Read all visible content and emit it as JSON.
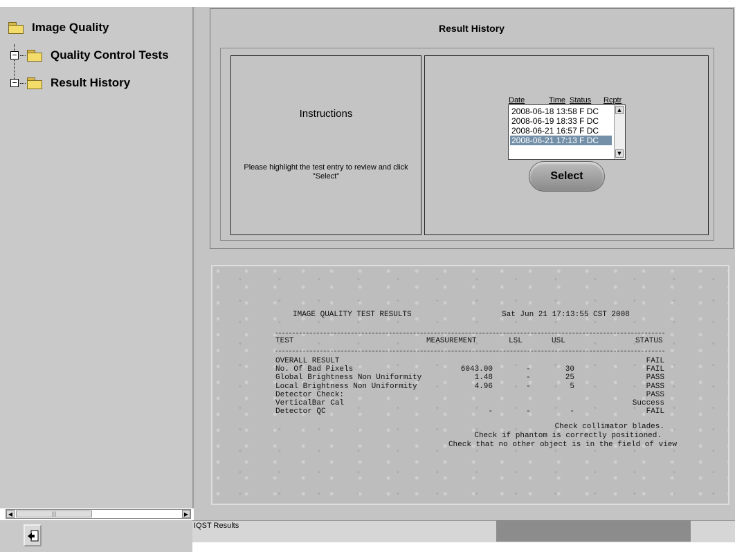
{
  "tree": {
    "root": "Image Quality",
    "children": [
      "Quality Control Tests",
      "Result History"
    ]
  },
  "panel": {
    "title": "Result History",
    "instructions_title": "Instructions",
    "instructions_text": "Please highlight the test entry to review and click \"Select\"",
    "list_headers": {
      "date": "Date",
      "time": "Time",
      "status": "Status",
      "rcptr": "Rcptr"
    },
    "entries": [
      "2008-06-18 13:58 F DC",
      "2008-06-19 18:33 F DC",
      "2008-06-21 16:57 F DC",
      "2008-06-21 17:13 F DC"
    ],
    "selected_index": 3,
    "select_label": "Select"
  },
  "results": {
    "title": "IMAGE QUALITY TEST RESULTS",
    "timestamp": "Sat Jun 21 17:13:55 CST 2008",
    "headers": {
      "test": "TEST",
      "measurement": "MEASUREMENT",
      "lsl": "LSL",
      "usl": "USL",
      "status": "STATUS"
    },
    "tests": "OVERALL RESULT\nNo. Of Bad Pixels\nGlobal Brightness Non Uniformity\nLocal Brightness Non Uniformity\nDetector Check:\nVerticalBar Cal\nDetector QC",
    "measurements": "\n6043.00\n1.48\n4.96\n\n\n-",
    "lsl": "\n-\n-\n-\n\n\n-",
    "usl": "\n30\n25\n5\n\n\n-",
    "status": "FAIL\nFAIL\nPASS\nPASS\nPASS\nSuccess\nFAIL",
    "notes": [
      "Check collimator blades.",
      "Check if phantom is correctly positioned.",
      "Check that no other object is in the field of view"
    ]
  },
  "statusbar": {
    "text": "IQST Results"
  },
  "icons": [
    "folder-icon",
    "tree-expander-icon",
    "exit-icon",
    "scroll-left-icon",
    "scroll-right-icon",
    "scroll-up-icon",
    "scroll-down-icon"
  ]
}
